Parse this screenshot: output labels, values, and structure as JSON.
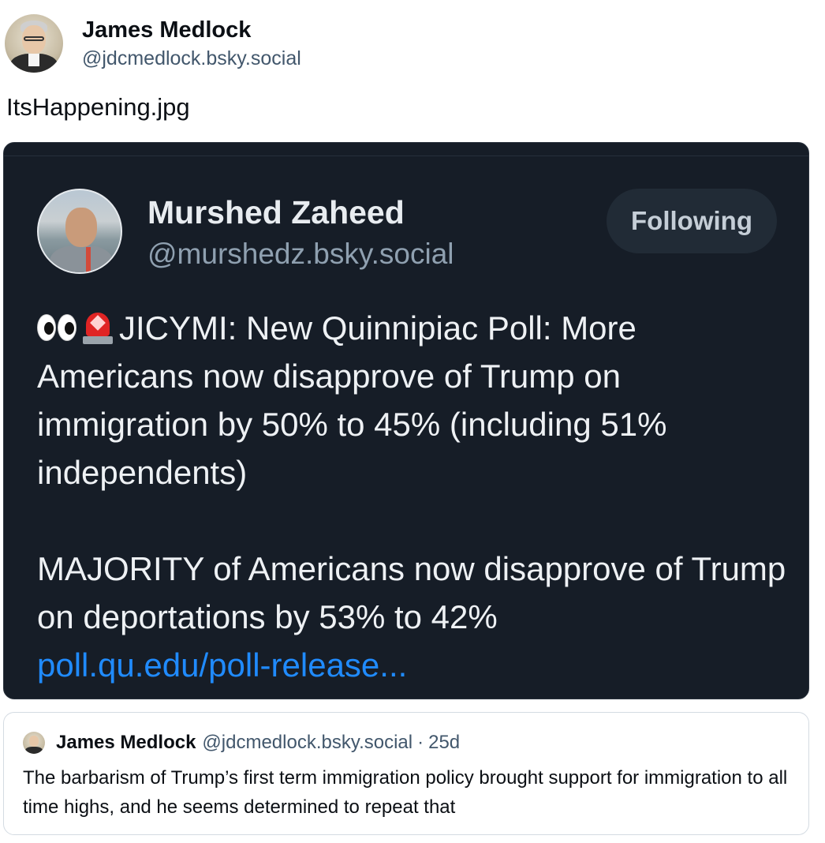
{
  "post": {
    "author_name": "James Medlock",
    "author_handle": "@jdcmedlock.bsky.social",
    "text": "ItsHappening.jpg"
  },
  "embed": {
    "author_name": "Murshed Zaheed",
    "author_handle": "@murshedz.bsky.social",
    "follow_label": "Following",
    "emoji_icons": [
      "eyes-icon",
      "siren-icon"
    ],
    "paragraph1": "JICYMI: New Quinnipiac Poll: More Americans now disapprove of Trump on immigration by 50% to 45% (including 51% independents)",
    "paragraph2": "MAJORITY of Americans now disapprove of Trump on deportations by 53% to 42%",
    "link": "poll.qu.edu/poll-release..."
  },
  "quote": {
    "author_name": "James Medlock",
    "author_handle": "@jdcmedlock.bsky.social",
    "separator": "·",
    "time": "25d",
    "text": "The barbarism of Trump’s first term immigration policy brought support for immigration to all time highs, and he seems determined to repeat that"
  },
  "colors": {
    "background": "#ffffff",
    "embed_background": "#161d27",
    "link": "#208bfe",
    "handle": "#42576c"
  }
}
